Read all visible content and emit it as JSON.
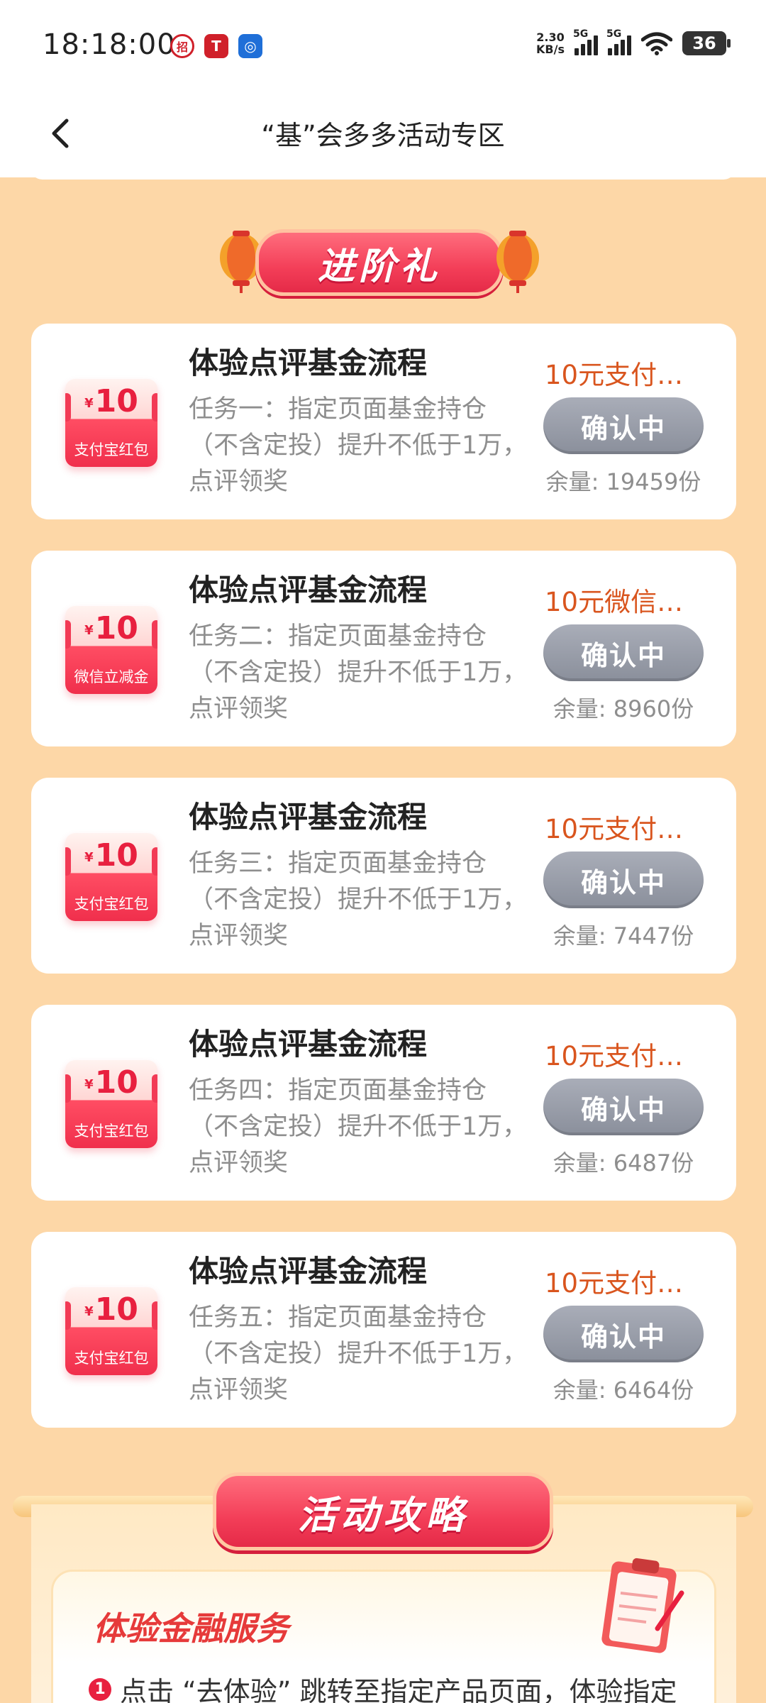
{
  "status_bar": {
    "time": "18:18:00",
    "net_speed_value": "2.30",
    "net_speed_unit": "KB/s",
    "signal1_label": "5G",
    "signal2_label": "5G",
    "battery": "36"
  },
  "header": {
    "title": "“基”会多多活动专区"
  },
  "section_banner": "进阶礼",
  "tasks": [
    {
      "title": "体验点评基金流程",
      "desc": "任务一：指定页面基金持仓（不含定投）提升不低于1万，点评领奖",
      "reward": "10元支付…",
      "coupon_amount": "10",
      "coupon_currency": "¥",
      "coupon_label": "支付宝红包",
      "button": "确认中",
      "stock": "余量: 19459份"
    },
    {
      "title": "体验点评基金流程",
      "desc": "任务二：指定页面基金持仓（不含定投）提升不低于1万，点评领奖",
      "reward": "10元微信…",
      "coupon_amount": "10",
      "coupon_currency": "¥",
      "coupon_label": "微信立减金",
      "button": "确认中",
      "stock": "余量: 8960份"
    },
    {
      "title": "体验点评基金流程",
      "desc": "任务三：指定页面基金持仓（不含定投）提升不低于1万，点评领奖",
      "reward": "10元支付…",
      "coupon_amount": "10",
      "coupon_currency": "¥",
      "coupon_label": "支付宝红包",
      "button": "确认中",
      "stock": "余量: 7447份"
    },
    {
      "title": "体验点评基金流程",
      "desc": "任务四：指定页面基金持仓（不含定投）提升不低于1万，点评领奖",
      "reward": "10元支付…",
      "coupon_amount": "10",
      "coupon_currency": "¥",
      "coupon_label": "支付宝红包",
      "button": "确认中",
      "stock": "余量: 6487份"
    },
    {
      "title": "体验点评基金流程",
      "desc": "任务五：指定页面基金持仓（不含定投）提升不低于1万，点评领奖",
      "reward": "10元支付…",
      "coupon_amount": "10",
      "coupon_currency": "¥",
      "coupon_label": "支付宝红包",
      "button": "确认中",
      "stock": "余量: 6464份"
    }
  ],
  "strategy": {
    "banner": "活动攻略",
    "card_title": "体验金融服务",
    "step_number": "1",
    "step_text": "点击 “去体验” 跳转至指定产品页面，体验指定"
  },
  "colors": {
    "page_bg": "#fdd7a7",
    "accent_red": "#f33e58",
    "reward_orange": "#d9551e",
    "button_gray": "#8a8f9b"
  }
}
